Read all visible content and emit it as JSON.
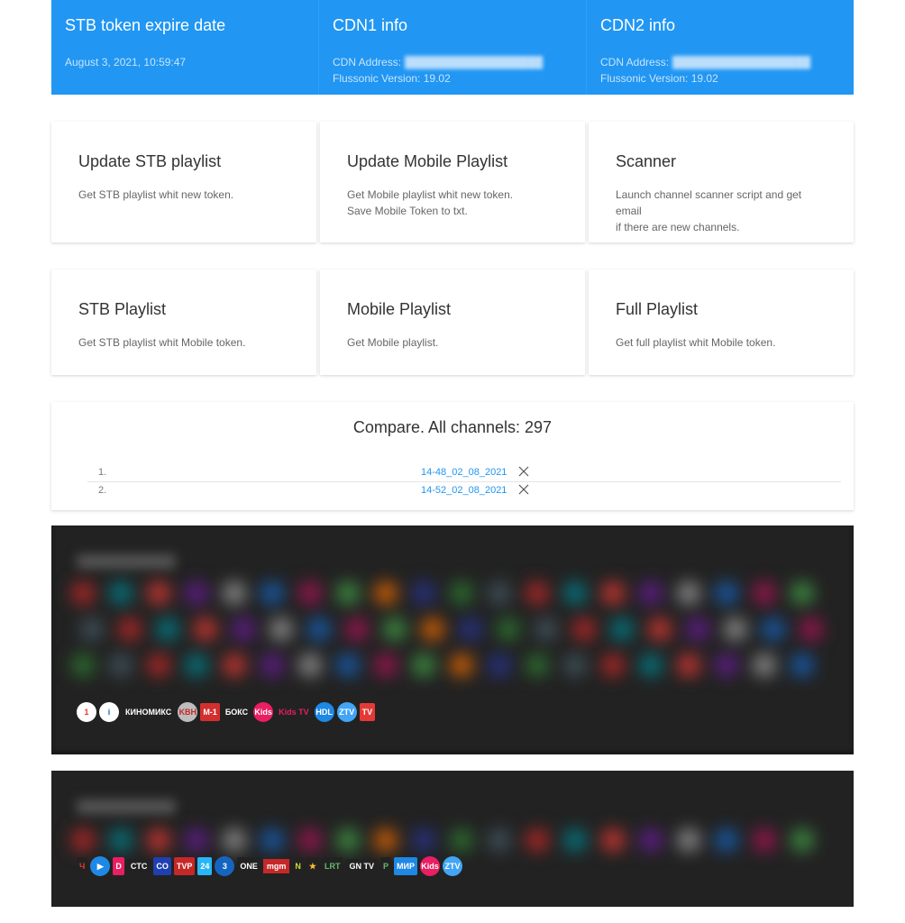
{
  "top_cards": [
    {
      "title": "STB token expire date",
      "lines": [
        "August 3, 2021, 10:59:47"
      ]
    },
    {
      "title": "CDN1 info",
      "address_label": "CDN Address:",
      "version_label": "Flussonic Version: 19.02"
    },
    {
      "title": "CDN2 info",
      "address_label": "CDN Address:",
      "version_label": "Flussonic Version: 19.02"
    }
  ],
  "actions_row1": [
    {
      "title": "Update STB playlist",
      "desc": [
        "Get STB playlist whit new token."
      ]
    },
    {
      "title": "Update Mobile Playlist",
      "desc": [
        "Get Mobile playlist whit new token.",
        "Save Mobile Token to txt."
      ]
    },
    {
      "title": "Scanner",
      "desc": [
        "Launch channel scanner script and get email",
        "if there are new channels."
      ]
    }
  ],
  "actions_row2": [
    {
      "title": "STB Playlist",
      "desc": [
        "Get STB playlist whit Mobile token."
      ]
    },
    {
      "title": "Mobile Playlist",
      "desc": [
        "Get Mobile playlist."
      ]
    },
    {
      "title": "Full Playlist",
      "desc": [
        "Get full playlist whit Mobile token."
      ]
    }
  ],
  "compare": {
    "title": "Compare. All channels: 297",
    "items": [
      {
        "num": "1.",
        "name": "14-48_02_08_2021"
      },
      {
        "num": "2.",
        "name": "14-52_02_08_2021"
      }
    ]
  },
  "channel_panel_1": {
    "logos": [
      {
        "text": "1",
        "color": "#ffffff",
        "fg": "#e53935",
        "shape": "round"
      },
      {
        "text": "i",
        "color": "#ffffff",
        "fg": "#1565c0",
        "shape": "round"
      },
      {
        "text": "КИНОМИКС",
        "color": "#222222",
        "fg": "#ffffff",
        "shape": "wide"
      },
      {
        "text": "KBH",
        "color": "#bdbdbd",
        "fg": "#c62828",
        "shape": "round"
      },
      {
        "text": "M-1",
        "color": "#d32f2f",
        "fg": "#ffffff",
        "shape": "box"
      },
      {
        "text": "БОКС",
        "color": "#222222",
        "fg": "#ffffff",
        "shape": "box"
      },
      {
        "text": "Kids",
        "color": "#e91e63",
        "fg": "#ffffff",
        "shape": "round"
      },
      {
        "text": "Kids TV",
        "color": "#222222",
        "fg": "#e91e63",
        "shape": "box"
      },
      {
        "text": "HDL",
        "color": "#1e88e5",
        "fg": "#ffffff",
        "shape": "round"
      },
      {
        "text": "ZTV",
        "color": "#42a5f5",
        "fg": "#ffffff",
        "shape": "round"
      },
      {
        "text": "TV",
        "color": "#e53935",
        "fg": "#ffffff",
        "shape": "box"
      }
    ]
  },
  "channel_panel_2": {
    "logos": [
      {
        "text": "Ч",
        "color": "#222222",
        "fg": "#e53935",
        "shape": "box"
      },
      {
        "text": "▶",
        "color": "#1e88e5",
        "fg": "#ffffff",
        "shape": "round"
      },
      {
        "text": "D",
        "color": "#e91e63",
        "fg": "#ffffff",
        "shape": "box"
      },
      {
        "text": "CTC",
        "color": "#222222",
        "fg": "#ffffff",
        "shape": "wide"
      },
      {
        "text": "CO",
        "color": "#1e40b0",
        "fg": "#ffffff",
        "shape": "box"
      },
      {
        "text": "TVP",
        "color": "#c62828",
        "fg": "#ffffff",
        "shape": "box"
      },
      {
        "text": "24",
        "color": "#29b6f6",
        "fg": "#ffffff",
        "shape": "box"
      },
      {
        "text": "3",
        "color": "#1565c0",
        "fg": "#ffffff",
        "shape": "round"
      },
      {
        "text": "ONE",
        "color": "#222222",
        "fg": "#ffffff",
        "shape": "box"
      },
      {
        "text": "mgm",
        "color": "#c62828",
        "fg": "#ffffff",
        "shape": "wide"
      },
      {
        "text": "N",
        "color": "#222222",
        "fg": "#cddc39",
        "shape": "box"
      },
      {
        "text": "★",
        "color": "#222222",
        "fg": "#fbc02d",
        "shape": "box"
      },
      {
        "text": "LRT",
        "color": "#222222",
        "fg": "#66bb6a",
        "shape": "box"
      },
      {
        "text": "GN TV",
        "color": "#222222",
        "fg": "#ffffff",
        "shape": "wide"
      },
      {
        "text": "P",
        "color": "#222222",
        "fg": "#66bb6a",
        "shape": "box"
      },
      {
        "text": "МИР",
        "color": "#1e88e5",
        "fg": "#ffffff",
        "shape": "box"
      },
      {
        "text": "Kids",
        "color": "#e91e63",
        "fg": "#ffffff",
        "shape": "round"
      },
      {
        "text": "ZTV",
        "color": "#42a5f5",
        "fg": "#ffffff",
        "shape": "round"
      }
    ]
  }
}
